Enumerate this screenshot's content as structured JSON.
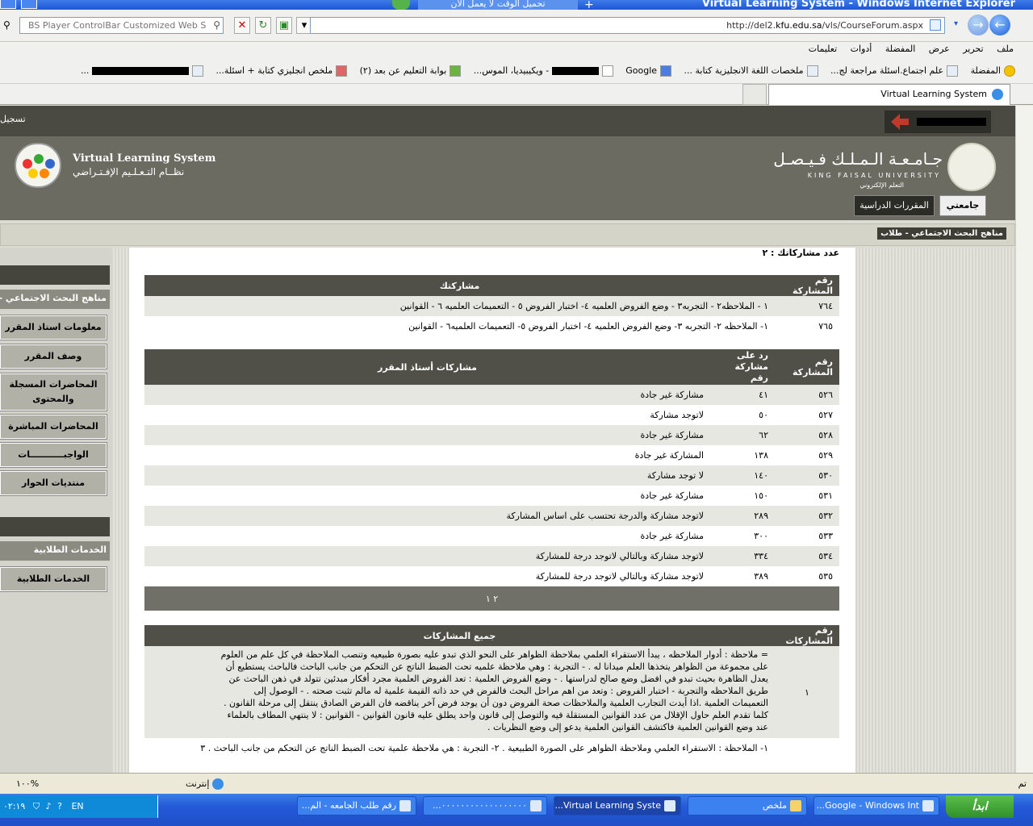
{
  "browser": {
    "window_title": "Virtual Learning System - Windows Internet Explorer",
    "popup_tab": "تحميل الوقت لا يعمل الآن",
    "url_prefix": "http://del2.",
    "url_host": "kfu.edu.sa",
    "url_path": "/vls/CourseForum.aspx",
    "search_placeholder": "BS Player ControlBar Customized Web Search",
    "menu": [
      "ملف",
      "تحرير",
      "عرض",
      "المفضلة",
      "أدوات",
      "تعليمات"
    ],
    "favorites": [
      {
        "label": "المفضلة",
        "icon": "star-icon"
      },
      {
        "label": "علم اجتماع.اسئلة مراجعة لج...",
        "icon": "page-icon"
      },
      {
        "label": "ملخصات اللغة الانجليزية كتابة ...",
        "icon": "page-icon"
      },
      {
        "label": "Google",
        "icon": "google-icon"
      },
      {
        "label": "- ويكيبيديا، الموس...",
        "icon": "wikipedia-icon"
      },
      {
        "label": "بوابة التعليم عن بعد (٢)",
        "icon": "kfu-icon"
      },
      {
        "label": "ملخص انجليزي كتابة + اسئلة...",
        "icon": "page-icon"
      },
      {
        "label": "...",
        "icon": "page-icon"
      }
    ],
    "tab_title": "Virtual Learning System",
    "status_done": "تم",
    "status_zone": "إنترنت",
    "zoom": "١٠٠%"
  },
  "site": {
    "login_label": "تسجيل",
    "vls_title_en": "Virtual Learning System",
    "vls_title_ar": "نظــام التـعـلـيم الإفـتـراضي",
    "university_ar": "جـامـعـة الـمـلـك فـيـصـل",
    "university_en": "KING FAISAL UNIVERSITY",
    "elearning_ar": "التعلم الإلكتروني",
    "nav_tabs": [
      {
        "label": "جامعتي",
        "active": true
      },
      {
        "label": "المقررات الدراسية",
        "active": false
      }
    ],
    "breadcrumb": "مناهج البحث الاجتماعي - طلاب"
  },
  "sidebar": {
    "course_title": "مناهج البحث الاجتماعي - ط",
    "items": [
      "معلومات استاذ المقرر",
      "وصف المقرر",
      "المحاضرات المسجلة والمحتوى",
      "المحاضرات المباشرة",
      "الواجبـــــــــــات",
      "منتديات الحوار"
    ],
    "services_title": "الخدمات الطلابية",
    "services_button": "الخدمات الطلابية"
  },
  "content": {
    "count_line": "عدد مشاركاتك : ٢",
    "my_posts": {
      "headers": [
        "رقم المشاركة",
        "مشاركتك"
      ],
      "rows": [
        [
          "٧٦٤",
          "١ - الملاحظه٢ - التجربه٣ - وضع الفروض العلميه ٤- اختبار الفروض ٥ - التعميمات العلميه ٦ - القوانين"
        ],
        [
          "٧٦٥",
          "١- الملاحظه ٢- التجربه ٣- وضع الفروض العلميه ٤- اختبار الفروض ٥- التعميمات العلميه٦ - القوانين"
        ]
      ]
    },
    "teacher_posts": {
      "headers": [
        "رقم المشاركة",
        "رد على مشاركة رقم",
        "مشاركات أستاذ المقرر"
      ],
      "rows": [
        [
          "٥٢٦",
          "٤١",
          "مشاركة غير جادة"
        ],
        [
          "٥٢٧",
          "٥٠",
          "لاتوجد مشاركة"
        ],
        [
          "٥٢٨",
          "٦٢",
          "مشاركة غير جادة"
        ],
        [
          "٥٢٩",
          "١٣٨",
          "المشاركة غير جادة"
        ],
        [
          "٥٣٠",
          "١٤٠",
          "لا توجد مشاركة"
        ],
        [
          "٥٣١",
          "١٥٠",
          "مشاركة غير جادة"
        ],
        [
          "٥٣٢",
          "٢٨٩",
          "لاتوجد مشاركة والدرجة تحتسب على اساس المشاركة"
        ],
        [
          "٥٣٣",
          "٣٠٠",
          "مشاركة غير جادة"
        ],
        [
          "٥٣٤",
          "٣٣٤",
          "لاتوجد مشاركة وبالتالي لاتوجد درجة للمشاركة"
        ],
        [
          "٥٣٥",
          "٣٨٩",
          "لاتوجد مشاركة وبالتالي لاتوجد درجة للمشاركة"
        ]
      ],
      "pages": "٢ ١"
    },
    "all_posts": {
      "headers": [
        "رقم المشاركات",
        "جميع المشاركات"
      ],
      "rows": [
        [
          "١",
          "= ملاحظة : أدوار الملاحظه ، يبدأ الاستقراء العلمي بملاحظة الظواهر على النحو الذي تبدو عليه بصورة طبيعيه وتنصب الملاحظة في كل علم من العلوم على مجموعة من الظواهر يتخذها العلم ميدانا له . - التجربة : وهي ملاحظة علميه تحت الضبط الناتج عن التحكم من جانب الباحث فالباحث يستطيع أن يعدل الظاهرة بحيث تبدو في افضل وضع صالح لدراستها . - وضع الفروض العلمية : تعد الفروض العلمية مجرد أفكار مبدئين تتولد في ذهن الباحث عن طريق الملاحظه والتجربة - اختبار الفروض : وتعد من اهم مراحل البحث فالفرض في حد ذاته القيمة علمية له مالم تثبت صحته . - الوصول إلى التعميمات العلمية .اذا أيدت التجارب العلمية والملاحظات صحة الفروض دون أن يوجد فرض آخر يناقضه فان الفرض الصادق ينتقل إلى مرحلة القانون . كلما تقدم العلم حاول الإقلال من عدد القوانين المستقلة فيه والتوصل إلى قانون واحد يطلق عليه قانون القوانين - القوانين : لا ينتهي المطاف بالعلماء عند وضع القوانين العلمية فاكتشف القوانين العلمية يدعو إلى وضع النظريات ."
        ],
        [
          "",
          "١- الملاحظة : الاستقراء العلمي وملاحظة الظواهر على الصورة الطبيعية . ٢- التجربة : هي ملاحظة علمية تحت الضبط الناتج عن التحكم من جانب الباحث . ٣"
        ]
      ]
    }
  },
  "taskbar": {
    "start_label": "ابدأ",
    "tasks": [
      {
        "label": "Google - Windows Int...",
        "active": false
      },
      {
        "label": "ملخص",
        "active": false
      },
      {
        "label": "Virtual Learning Syste...",
        "active": true
      },
      {
        "label": "٠٠٠٠٠٠٠٠٠٠٠٠٠٠٠٠٠٠...",
        "active": false
      },
      {
        "label": "رقم طلب الجامعه - الم...",
        "active": false
      }
    ],
    "lang": "EN",
    "clock": "٠٢:١٩"
  }
}
